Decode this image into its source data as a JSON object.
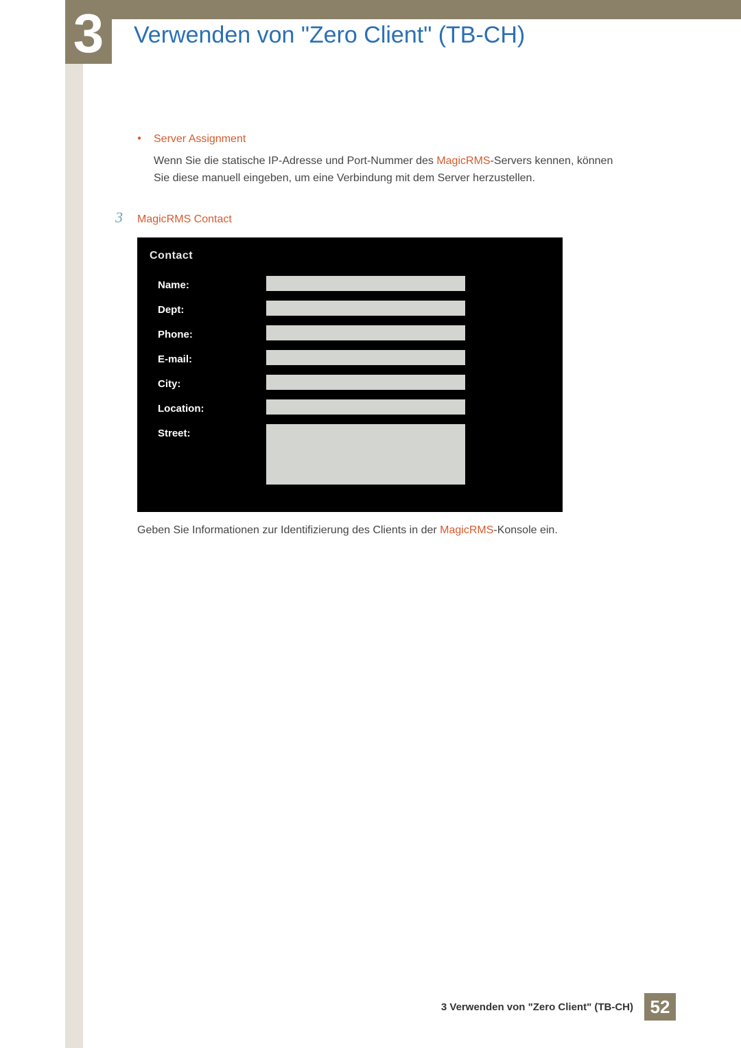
{
  "chapter": {
    "number": "3",
    "title": "Verwenden von \"Zero Client\" (TB-CH)"
  },
  "bullet": {
    "heading": "Server Assignment",
    "body_pre": "Wenn Sie die statische IP-Adresse und Port-Nummer des ",
    "body_hl": "MagicRMS",
    "body_post": "-Servers kennen, können Sie diese manuell eingeben, um eine Verbindung mit dem Server herzustellen."
  },
  "step": {
    "number": "3",
    "heading": "MagicRMS Contact"
  },
  "screenshot": {
    "title": "Contact",
    "fields": {
      "name": "Name:",
      "dept": "Dept:",
      "phone": "Phone:",
      "email": "E-mail:",
      "city": "City:",
      "location": "Location:",
      "street": "Street:"
    }
  },
  "caption": {
    "pre": "Geben Sie Informationen zur Identifizierung des Clients in der ",
    "hl": "MagicRMS",
    "post": "-Konsole ein."
  },
  "footer": {
    "text": "3 Verwenden von \"Zero Client\" (TB-CH)",
    "page": "52"
  }
}
